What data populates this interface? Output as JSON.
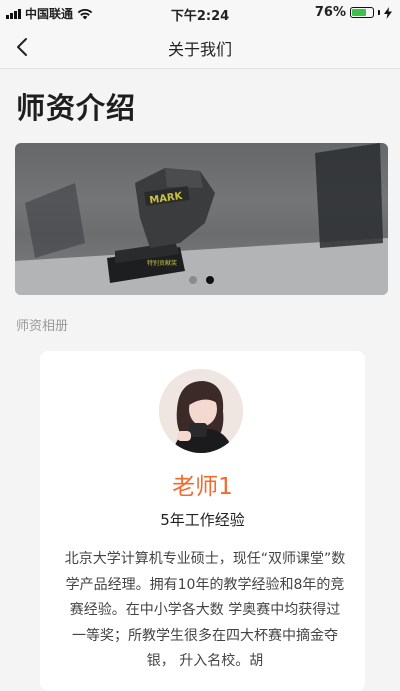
{
  "status_bar": {
    "carrier": "中国联通",
    "time": "下午2:24",
    "battery": "76%",
    "battery_level": 0.76,
    "icons": [
      "signal-icon",
      "wifi-icon",
      "battery-icon",
      "charging-bolt-icon"
    ]
  },
  "nav": {
    "back_icon": "chevron-left-icon",
    "title": "关于我们"
  },
  "page": {
    "title": "师资介绍",
    "banner": {
      "trophy_text": "MARK",
      "plaque_text": "特别贡献奖",
      "slide_count": 2,
      "active_slide": 2
    },
    "section_label": "师资相册"
  },
  "teacher": {
    "name": "老师1",
    "experience": "5年工作经验",
    "bio": "北京大学计算机专业硕士，现任“双师课堂”数学产品经理。拥有10年的教学经验和8年的竞赛经验。在中小学各大数 学奥赛中均获得过一等奖；所教学生很多在四大杯赛中摘金夺银， 升入名校。胡"
  },
  "colors": {
    "accent": "#f46a2d",
    "background": "#f4f4f4",
    "card": "#ffffff",
    "battery": "#3cc04a"
  }
}
